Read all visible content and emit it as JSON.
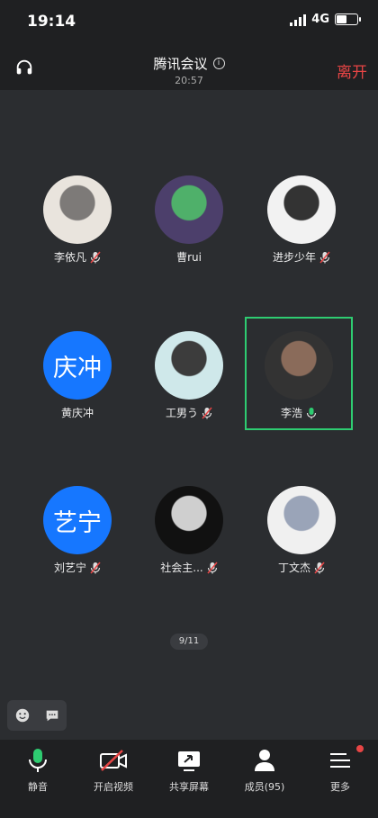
{
  "status_bar": {
    "time": "19:14",
    "network": "4G"
  },
  "header": {
    "title": "腾讯会议",
    "timer": "20:57",
    "leave_label": "离开"
  },
  "participants": [
    {
      "name": "李依凡",
      "muted": true,
      "avatar": "photo",
      "colors": [
        "#e9e4dd",
        "#7d7a78"
      ]
    },
    {
      "name": "曹rui",
      "muted": false,
      "avatar": "photo",
      "colors": [
        "#4c3f6b",
        "#4fb06a"
      ]
    },
    {
      "name": "进步少年",
      "muted": true,
      "avatar": "photo",
      "colors": [
        "#f2f2f2",
        "#333333"
      ]
    },
    {
      "name": "黄庆冲",
      "muted": false,
      "avatar": "text",
      "text": "庆冲"
    },
    {
      "name": "工男う",
      "muted": true,
      "avatar": "photo",
      "colors": [
        "#cfe8ea",
        "#3c3c3c"
      ]
    },
    {
      "name": "李浩",
      "muted": false,
      "speaking": true,
      "avatar": "photo",
      "colors": [
        "#333333",
        "#8a6b5a"
      ]
    },
    {
      "name": "刘艺宁",
      "muted": true,
      "avatar": "text",
      "text": "艺宁"
    },
    {
      "name": "社会主...",
      "muted": true,
      "avatar": "photo",
      "colors": [
        "#111111",
        "#cfcfcf"
      ]
    },
    {
      "name": "丁文杰",
      "muted": true,
      "avatar": "photo",
      "colors": [
        "#f0f0f0",
        "#9aa4b8"
      ]
    }
  ],
  "page_indicator": "9/11",
  "toolbar": [
    {
      "label": "静音",
      "icon": "mic-icon"
    },
    {
      "label": "开启视频",
      "icon": "video-off-icon"
    },
    {
      "label": "共享屏幕",
      "icon": "share-screen-icon"
    },
    {
      "label": "成员(95)",
      "icon": "members-icon"
    },
    {
      "label": "更多",
      "icon": "more-icon"
    }
  ],
  "colors": {
    "accent_green": "#2ecc71",
    "leave_red": "#e84545",
    "avatar_blue": "#1677ff"
  }
}
